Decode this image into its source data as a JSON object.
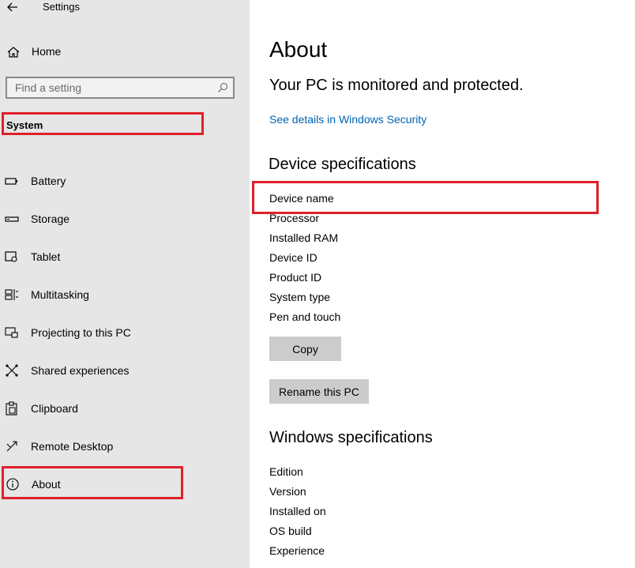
{
  "window": {
    "title": "Settings"
  },
  "sidebar": {
    "home_label": "Home",
    "search_placeholder": "Find a setting",
    "section_title": "System",
    "items": [
      {
        "label": "Battery",
        "icon": "battery-icon"
      },
      {
        "label": "Storage",
        "icon": "storage-icon"
      },
      {
        "label": "Tablet",
        "icon": "tablet-icon"
      },
      {
        "label": "Multitasking",
        "icon": "multitasking-icon"
      },
      {
        "label": "Projecting to this PC",
        "icon": "projecting-icon"
      },
      {
        "label": "Shared experiences",
        "icon": "shared-experiences-icon"
      },
      {
        "label": "Clipboard",
        "icon": "clipboard-icon"
      },
      {
        "label": "Remote Desktop",
        "icon": "remote-desktop-icon"
      },
      {
        "label": "About",
        "icon": "info-icon"
      }
    ]
  },
  "main": {
    "title": "About",
    "protection_status": "Your PC is monitored and protected.",
    "security_link": "See details in Windows Security",
    "device_specs": {
      "heading": "Device specifications",
      "rows": [
        "Device name",
        "Processor",
        "Installed RAM",
        "Device ID",
        "Product ID",
        "System type",
        "Pen and touch"
      ]
    },
    "copy_label": "Copy",
    "rename_label": "Rename this PC",
    "windows_specs": {
      "heading": "Windows specifications",
      "rows": [
        "Edition",
        "Version",
        "Installed on",
        "OS build",
        "Experience"
      ]
    }
  },
  "colors": {
    "accent_link": "#0063b1",
    "highlight": "#e0202a",
    "sidebar_bg": "#e6e6e6"
  }
}
